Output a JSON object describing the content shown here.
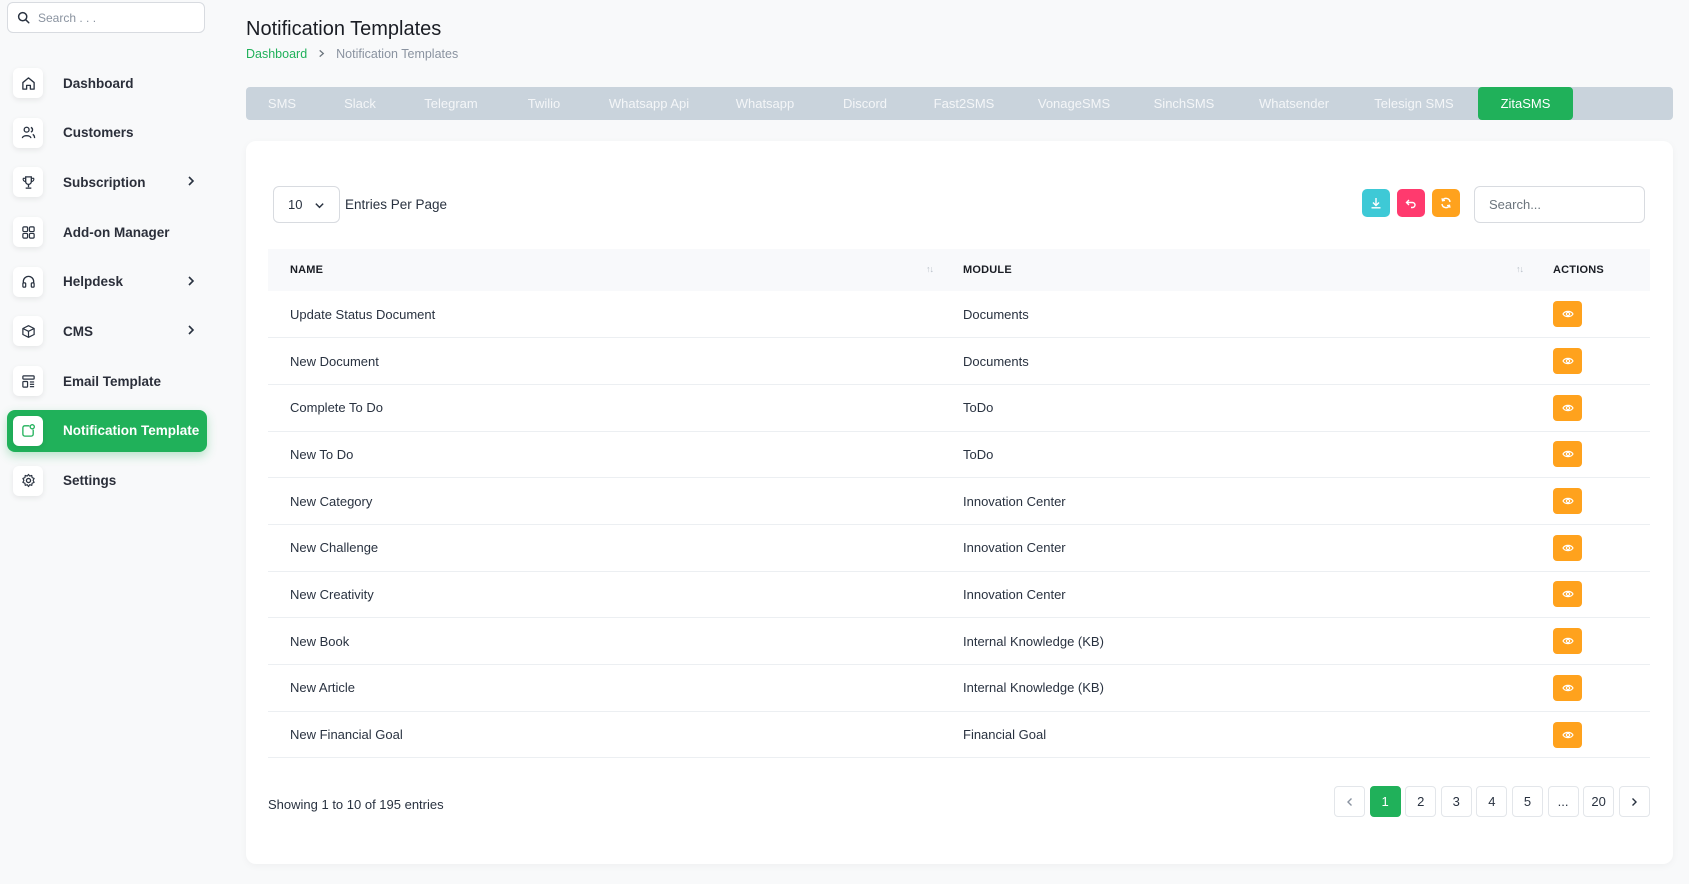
{
  "sidebar": {
    "search_placeholder": "Search . . .",
    "items": [
      {
        "label": "Dashboard",
        "icon": "home-icon"
      },
      {
        "label": "Customers",
        "icon": "users-icon"
      },
      {
        "label": "Subscription",
        "icon": "trophy-icon",
        "has_children": true
      },
      {
        "label": "Add-on Manager",
        "icon": "apps-icon"
      },
      {
        "label": "Helpdesk",
        "icon": "headphones-icon",
        "has_children": true
      },
      {
        "label": "CMS",
        "icon": "package-icon",
        "has_children": true
      },
      {
        "label": "Email Template",
        "icon": "template-icon"
      },
      {
        "label": "Notification Template",
        "icon": "notification-icon",
        "active": true
      },
      {
        "label": "Settings",
        "icon": "gear-icon"
      }
    ]
  },
  "header": {
    "title": "Notification Templates",
    "breadcrumb": {
      "home": "Dashboard",
      "current": "Notification Templates"
    }
  },
  "tabs": [
    {
      "label": "SMS"
    },
    {
      "label": "Slack"
    },
    {
      "label": "Telegram"
    },
    {
      "label": "Twilio"
    },
    {
      "label": "Whatsapp Api"
    },
    {
      "label": "Whatsapp"
    },
    {
      "label": "Discord"
    },
    {
      "label": "Fast2SMS"
    },
    {
      "label": "VonageSMS"
    },
    {
      "label": "SinchSMS"
    },
    {
      "label": "Whatsender"
    },
    {
      "label": "Telesign SMS"
    },
    {
      "label": "ZitaSMS",
      "active": true
    }
  ],
  "table_controls": {
    "entries_value": "10",
    "entries_label": "Entries Per Page",
    "search_placeholder": "Search..."
  },
  "table": {
    "columns": [
      "NAME",
      "MODULE",
      "ACTIONS"
    ],
    "rows": [
      {
        "name": "Update Status Document",
        "module": "Documents"
      },
      {
        "name": "New Document",
        "module": "Documents"
      },
      {
        "name": "Complete To Do",
        "module": "ToDo"
      },
      {
        "name": "New To Do",
        "module": "ToDo"
      },
      {
        "name": "New Category",
        "module": "Innovation Center"
      },
      {
        "name": "New Challenge",
        "module": "Innovation Center"
      },
      {
        "name": "New Creativity",
        "module": "Innovation Center"
      },
      {
        "name": "New Book",
        "module": "Internal Knowledge (KB)"
      },
      {
        "name": "New Article",
        "module": "Internal Knowledge (KB)"
      },
      {
        "name": "New Financial Goal",
        "module": "Financial Goal"
      }
    ]
  },
  "footer": {
    "showing": "Showing 1 to 10 of 195 entries",
    "pages": [
      "1",
      "2",
      "3",
      "4",
      "5",
      "...",
      "20"
    ],
    "current_page": "1"
  },
  "colors": {
    "accent": "#20b15a",
    "tab_bar": "#c9d3dc",
    "download": "#3ec9d6",
    "reset": "#ff3a6e",
    "refresh": "#ffa21d",
    "view": "#ffa21d"
  }
}
